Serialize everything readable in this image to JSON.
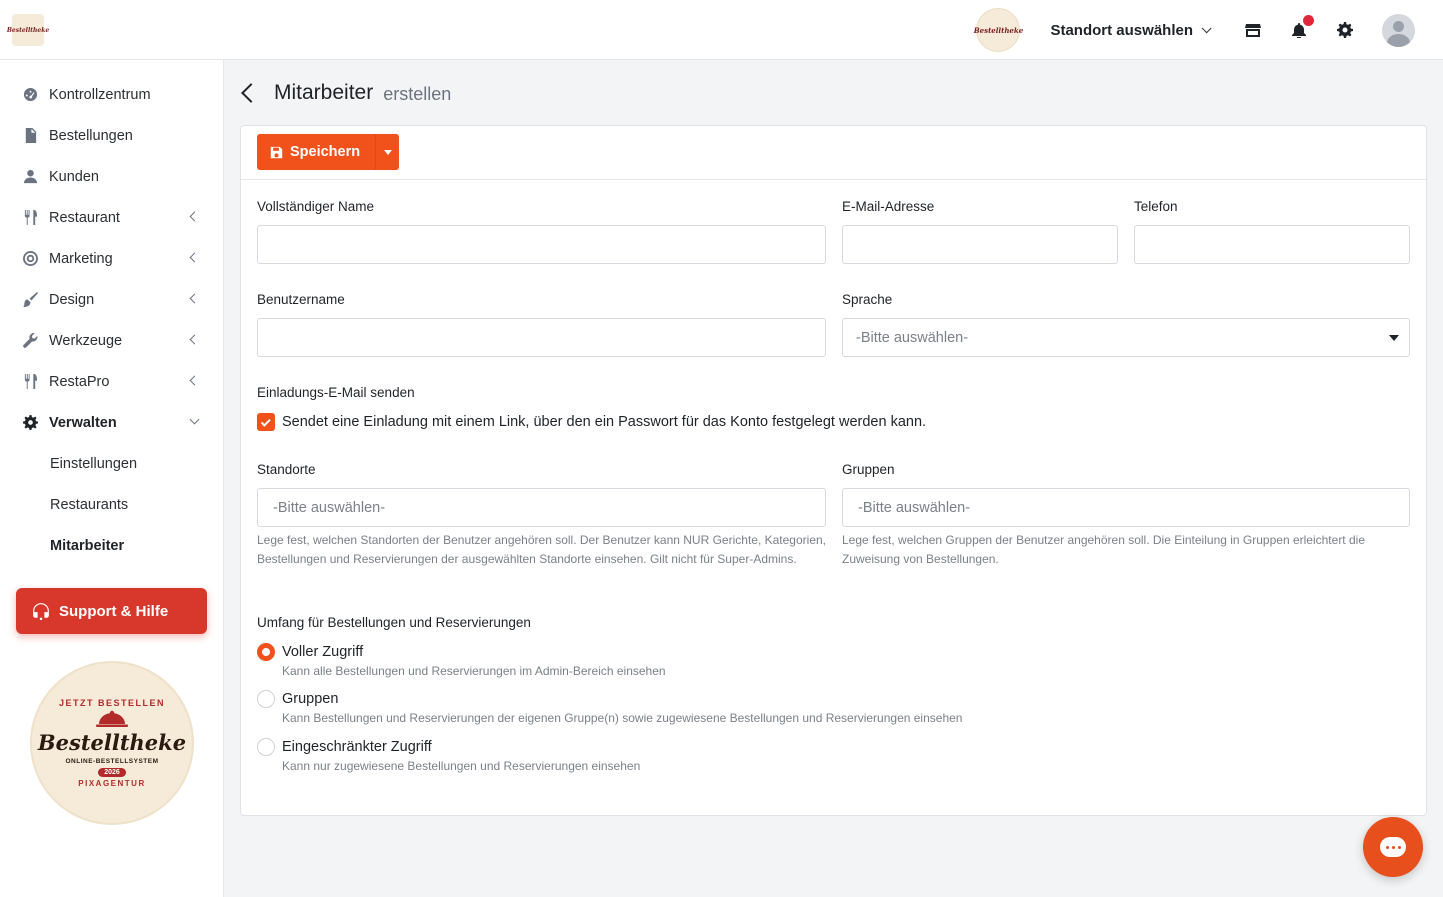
{
  "topbar": {
    "logo_text": "Bestelltheke",
    "location_select": "Standort auswählen",
    "icons": [
      "store-icon",
      "bell-icon",
      "gear-icon",
      "user-avatar-icon"
    ],
    "notification_color": "#e0263b"
  },
  "sidebar": {
    "items": [
      {
        "label": "Kontrollzentrum",
        "icon": "dashboard-icon"
      },
      {
        "label": "Bestellungen",
        "icon": "orders-icon"
      },
      {
        "label": "Kunden",
        "icon": "user-icon"
      },
      {
        "label": "Restaurant",
        "icon": "utensils-icon",
        "expandable": true
      },
      {
        "label": "Marketing",
        "icon": "target-icon",
        "expandable": true
      },
      {
        "label": "Design",
        "icon": "brush-icon",
        "expandable": true
      },
      {
        "label": "Werkzeuge",
        "icon": "wrench-icon",
        "expandable": true
      },
      {
        "label": "RestaPro",
        "icon": "utensils-icon",
        "expandable": true
      },
      {
        "label": "Verwalten",
        "icon": "gear-icon",
        "expanded": true
      }
    ],
    "subitems": [
      {
        "label": "Einstellungen"
      },
      {
        "label": "Restaurants"
      },
      {
        "label": "Mitarbeiter",
        "current": true
      }
    ],
    "support_label": "Support & Hilfe",
    "badge": {
      "arc_top": "JETZT BESTELLEN",
      "brand": "Bestelltheke",
      "subtitle": "ONLINE-BESTELLSYSTEM",
      "year": "2026",
      "arc_bottom": "PIXAGENTUR"
    }
  },
  "page": {
    "title": "Mitarbeiter",
    "subtitle": "erstellen"
  },
  "toolbar": {
    "save_label": "Speichern"
  },
  "form": {
    "full_name": {
      "label": "Vollständiger Name",
      "value": ""
    },
    "email": {
      "label": "E-Mail-Adresse",
      "value": ""
    },
    "phone": {
      "label": "Telefon",
      "value": ""
    },
    "username": {
      "label": "Benutzername",
      "value": ""
    },
    "language": {
      "label": "Sprache",
      "value": "-Bitte auswählen-"
    },
    "invite": {
      "label": "Einladungs-E-Mail senden",
      "checked": true,
      "text": "Sendet eine Einladung mit einem Link, über den ein Passwort für das Konto festgelegt werden kann."
    },
    "locations": {
      "label": "Standorte",
      "value": "-Bitte auswählen-",
      "help": "Lege fest, welchen Standorten der Benutzer angehören soll. Der Benutzer kann NUR Gerichte, Kategorien, Bestellungen und Reservierungen der ausgewählten Standorte einsehen. Gilt nicht für Super-Admins."
    },
    "groups": {
      "label": "Gruppen",
      "value": "-Bitte auswählen-",
      "help": "Lege fest, welchen Gruppen der Benutzer angehören soll. Die Einteilung in Gruppen erleichtert die Zuweisung von Bestellungen."
    },
    "scope": {
      "label": "Umfang für Bestellungen und Reservierungen",
      "options": [
        {
          "title": "Voller Zugriff",
          "desc": "Kann alle Bestellungen und Reservierungen im Admin-Bereich einsehen",
          "selected": true
        },
        {
          "title": "Gruppen",
          "desc": "Kann Bestellungen und Reservierungen der eigenen Gruppe(n) sowie zugewiesene Bestellungen und Reservierungen einsehen",
          "selected": false
        },
        {
          "title": "Eingeschränkter Zugriff",
          "desc": "Kann nur zugewiesene Bestellungen und Reservierungen einsehen",
          "selected": false
        }
      ]
    }
  },
  "colors": {
    "accent": "#f1511b",
    "support": "#d8382c",
    "chat": "#e74f1c"
  }
}
